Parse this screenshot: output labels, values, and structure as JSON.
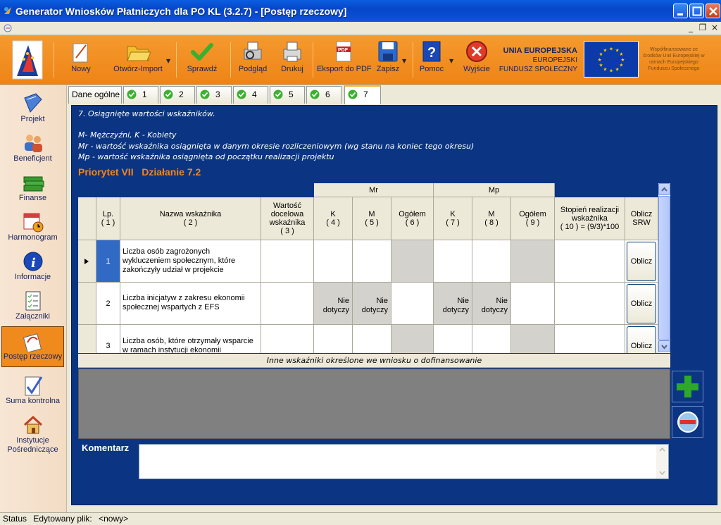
{
  "window": {
    "title": "Generator Wniosków Płatniczych dla PO KL (3.2.7) - [Postęp rzeczowy]"
  },
  "toolbar": {
    "buttons": [
      {
        "label": "Nowy",
        "icon": "new-document-icon"
      },
      {
        "label": "Otwórz-Import",
        "icon": "open-folder-icon"
      },
      {
        "label": "Sprawdź",
        "icon": "check-icon"
      },
      {
        "label": "Podgląd",
        "icon": "preview-icon"
      },
      {
        "label": "Drukuj",
        "icon": "printer-icon"
      },
      {
        "label": "Eksport do PDF",
        "icon": "pdf-icon"
      },
      {
        "label": "Zapisz",
        "icon": "save-disk-icon"
      },
      {
        "label": "Pomoc",
        "icon": "help-icon"
      },
      {
        "label": "Wyjście",
        "icon": "exit-icon"
      }
    ],
    "eu": {
      "line1": "UNIA EUROPEJSKA",
      "line2": "EUROPEJSKI",
      "line3": "FUNDUSZ SPOŁECZNY",
      "note": "Współfinansowane ze środków Unii Europejskiej w ramach Europejskiego Funduszu Społecznego"
    }
  },
  "sidebar": {
    "items": [
      {
        "label": "Projekt",
        "icon": "book-icon"
      },
      {
        "label": "Beneficjent",
        "icon": "people-icon"
      },
      {
        "label": "Finanse",
        "icon": "money-icon"
      },
      {
        "label": "Harmonogram",
        "icon": "calendar-clock-icon"
      },
      {
        "label": "Informacje",
        "icon": "info-icon"
      },
      {
        "label": "Załączniki",
        "icon": "checklist-icon"
      },
      {
        "label": "Postęp rzeczowy",
        "icon": "progress-icon"
      },
      {
        "label": "Suma kontrolna",
        "icon": "checksum-icon"
      },
      {
        "label": "Instytucje",
        "label2": "Pośredniczące",
        "icon": "house-icon"
      }
    ]
  },
  "tabs": [
    "Dane ogólne",
    "1",
    "2",
    "3",
    "4",
    "5",
    "6",
    "7"
  ],
  "section": {
    "heading": "7. Osiągnięte wartości wskaźników.",
    "legend1": "M- Mężczyźni, K - Kobiety",
    "legend2": "Mr - wartość wskaźnika osiągnięta w danym okresie rozliczeniowym (wg stanu na koniec tego okresu)",
    "legend3": "Mp - wartość wskaźnika osiągnięta od początku realizacji projektu",
    "priority": "Priorytet  VII",
    "action": "Działanie  7.2"
  },
  "grid": {
    "group_mr": "Mr",
    "group_mp": "Mp",
    "headers": {
      "lp": "Lp.",
      "lp_n": "( 1 )",
      "name": "Nazwa wskaźnika",
      "name_n": "( 2 )",
      "target1": "Wartość",
      "target2": "docelowa",
      "target3": "wskaźnika",
      "target_n": "( 3 )",
      "k": "K",
      "k_n": "( 4 )",
      "m": "M",
      "m_n": "( 5 )",
      "total": "Ogółem",
      "total_n": "( 6 )",
      "k2": "K",
      "k2_n": "( 7 )",
      "m2": "M",
      "m2_n": "( 8 )",
      "total2": "Ogółem",
      "total2_n": "( 9 )",
      "degree1": "Stopień realizacji",
      "degree2": "wskaźnika",
      "degree3": "( 10 ) = (9/3)*100",
      "calc1": "Oblicz",
      "calc2": "SRW"
    },
    "rows": [
      {
        "lp": "1",
        "name": "Liczba osób zagrożonych wykluczeniem społecznym, które zakończyły udział w projekcie",
        "button": "Oblicz"
      },
      {
        "lp": "2",
        "name": "Liczba inicjatyw z zakresu ekonomii społecznej wspartych z EFS",
        "nd1": "Nie",
        "nd2": "dotyczy",
        "button": "Oblicz"
      },
      {
        "lp": "3",
        "name": "Liczba osób, które otrzymały wsparcie w ramach instytucji ekonomii społecznej",
        "button": "Oblicz"
      }
    ]
  },
  "other_indicators": "Inne wskaźniki określone we wniosku o dofinansowanie",
  "comment_label": "Komentarz",
  "status": {
    "label": "Status",
    "file_label": "Edytowany plik:",
    "file_value": "<nowy>"
  }
}
